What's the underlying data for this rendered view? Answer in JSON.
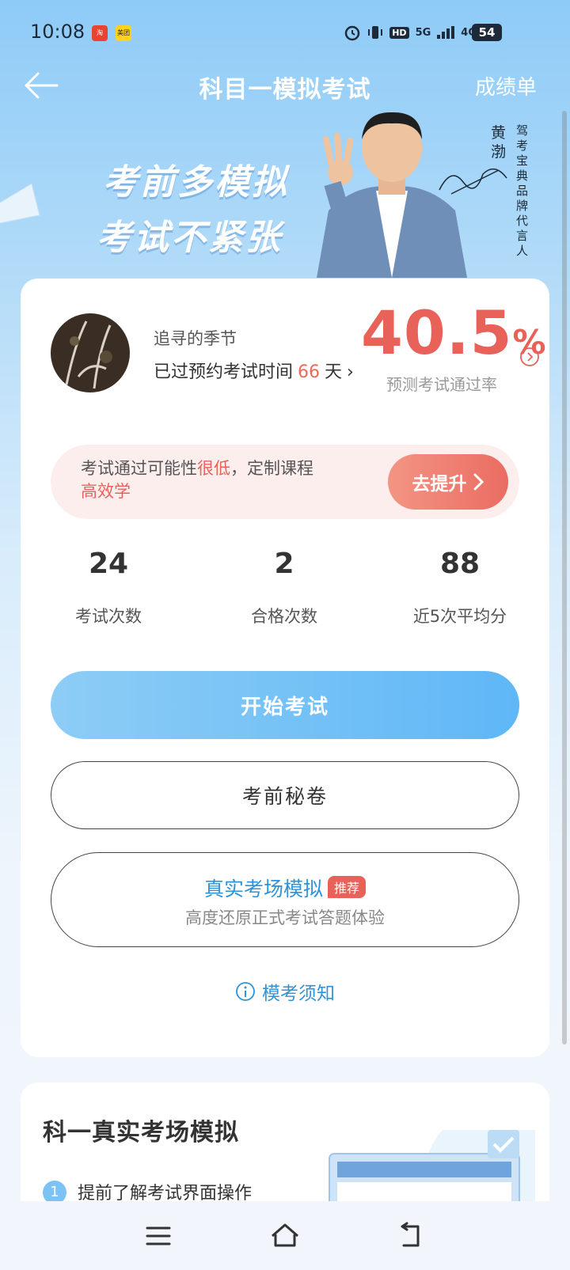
{
  "status_bar": {
    "time": "10:08",
    "badge_app1": "淘",
    "badge_app2": "美团",
    "network_1": "5G",
    "network_2": "4G",
    "battery": "54"
  },
  "header": {
    "title": "科目一模拟考试",
    "right_link": "成绩单"
  },
  "banner": {
    "slogan_line1": "考前多模拟",
    "slogan_line2": "考试不紧张",
    "spokesperson_name": "黄渤",
    "spokesperson_title": "驾考宝典品牌代言人"
  },
  "profile": {
    "username": "追寻的季节",
    "days_prefix": "已过预约考试时间",
    "days_value": "66",
    "days_suffix": "天",
    "pass_rate_value": "40.5",
    "pass_rate_unit": "%",
    "pass_rate_caption": "预测考试通过率"
  },
  "alert": {
    "text_prefix": "考试通过可能性",
    "text_low": "很低",
    "text_middle": "，定制课程",
    "text_efficient": "高效学",
    "button_label": "去提升"
  },
  "stats": [
    {
      "value": "24",
      "label": "考试次数"
    },
    {
      "value": "2",
      "label": "合格次数"
    },
    {
      "value": "88",
      "label": "近5次平均分"
    }
  ],
  "actions": {
    "start_exam": "开始考试",
    "secret_paper": "考前秘卷",
    "real_sim_title": "真实考场模拟",
    "real_sim_badge": "推荐",
    "real_sim_subtitle": "高度还原正式考试答题体验",
    "notice": "模考须知"
  },
  "lower_section": {
    "title": "科一真实考场模拟",
    "step_number": "1",
    "step_text": "提前了解考试界面操作"
  },
  "colors": {
    "accent_blue": "#5fb7f7",
    "accent_red": "#e8625a",
    "link_blue": "#2e93d9"
  }
}
